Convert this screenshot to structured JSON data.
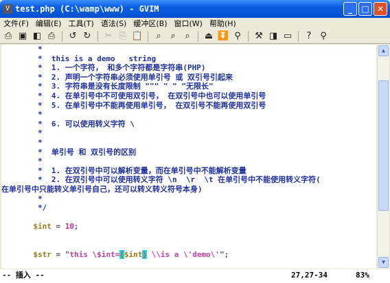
{
  "window": {
    "title": "test.php (C:\\wamp\\www) - GVIM",
    "buttons": [
      "_",
      "□",
      "✕"
    ]
  },
  "menu": [
    "文件(F)",
    "编辑(E)",
    "工具(T)",
    "语法(S)",
    "缓冲区(B)",
    "窗口(W)",
    "帮助(H)"
  ],
  "toolbar": [
    {
      "icon": "open-icon",
      "glyph": "⎙"
    },
    {
      "icon": "save-icon",
      "glyph": "▣"
    },
    {
      "icon": "save-all-icon",
      "glyph": "◧"
    },
    {
      "icon": "print-icon",
      "glyph": "⎙"
    },
    {
      "sep": true
    },
    {
      "icon": "undo-icon",
      "glyph": "↺"
    },
    {
      "icon": "redo-icon",
      "glyph": "↻"
    },
    {
      "sep": true
    },
    {
      "icon": "cut-icon",
      "glyph": "✂",
      "disabled": true
    },
    {
      "icon": "copy-icon",
      "glyph": "⎘",
      "disabled": true
    },
    {
      "icon": "paste-icon",
      "glyph": "📋"
    },
    {
      "sep": true
    },
    {
      "icon": "find-replace-icon",
      "glyph": "⌕"
    },
    {
      "icon": "find-next-icon",
      "glyph": "⌕"
    },
    {
      "icon": "find-prev-icon",
      "glyph": "⌕"
    },
    {
      "sep": true
    },
    {
      "icon": "load-session-icon",
      "glyph": "⏏"
    },
    {
      "icon": "save-session-icon",
      "glyph": "⏬"
    },
    {
      "icon": "run-script-icon",
      "glyph": "⚲"
    },
    {
      "sep": true
    },
    {
      "icon": "make-icon",
      "glyph": "⚒"
    },
    {
      "icon": "shell-icon",
      "glyph": "◨"
    },
    {
      "icon": "tag-icon",
      "glyph": "▭"
    },
    {
      "sep": true
    },
    {
      "icon": "help-icon",
      "glyph": "?"
    },
    {
      "icon": "find-help-icon",
      "glyph": "⚲"
    }
  ],
  "editor": {
    "lines": [
      [
        {
          "c": "cm",
          "t": "        *"
        }
      ],
      [
        {
          "c": "cm",
          "t": "        *  this is a demo   string"
        }
      ],
      [
        {
          "c": "cm",
          "t": "        *  1. 一个字符， 和多个字符都是字符串(PHP)"
        }
      ],
      [
        {
          "c": "cm",
          "t": "        *  2. 声明一个字符串必须使用单引号 或 双引号引起来"
        }
      ],
      [
        {
          "c": "cm",
          "t": "        *  3. 字符串是没有长度限制 \"\"\" \" \" \"无限长\""
        }
      ],
      [
        {
          "c": "cm",
          "t": "        *  4. 在单引号中不可使用双引号， 在双引号中也可以使用单引号"
        }
      ],
      [
        {
          "c": "cm",
          "t": "        *  5. 在单引号中不能再使用单引号， 在双引号不能再使用双引号"
        }
      ],
      [
        {
          "c": "cm",
          "t": "        *"
        }
      ],
      [
        {
          "c": "cm",
          "t": "        *  6. 可以使用转义字符 \\"
        }
      ],
      [
        {
          "c": "cm",
          "t": "        *"
        }
      ],
      [
        {
          "c": "cm",
          "t": "        *"
        }
      ],
      [
        {
          "c": "cm",
          "t": "        *  单引号 和 双引号的区别"
        }
      ],
      [
        {
          "c": "cm",
          "t": "        *"
        }
      ],
      [
        {
          "c": "cm",
          "t": "        *  1. 在双引号中可以解析变量，而在单引号中不能解析变量"
        }
      ],
      [
        {
          "c": "cm",
          "t": "        *  2. 在双引号中可以使用转义字符 \\n  \\r  \\t 在单引号中不能使用转义字符("
        }
      ],
      [
        {
          "c": "cm",
          "t": "在单引号中只能转义单引号自己，还可以转义转义符号本身)"
        }
      ],
      [
        {
          "c": "cm",
          "t": "        *"
        }
      ],
      [
        {
          "c": "cm",
          "t": "        */"
        }
      ],
      [
        {
          "c": "cm",
          "t": ""
        }
      ],
      [
        {
          "c": "var",
          "t": "       $int"
        },
        {
          "c": "op",
          "t": " = "
        },
        {
          "c": "num",
          "t": "10"
        },
        {
          "c": "op",
          "t": ";"
        }
      ],
      [
        {
          "c": "cm",
          "t": ""
        }
      ],
      [
        {
          "c": "cm",
          "t": ""
        }
      ],
      [
        {
          "c": "var",
          "t": "       $str"
        },
        {
          "c": "op",
          "t": " = \""
        },
        {
          "c": "str",
          "t": "this \\$int="
        },
        {
          "c": "hl",
          "t": "{"
        },
        {
          "c": "var",
          "t": "$int"
        },
        {
          "c": "hl",
          "t": "}"
        },
        {
          "c": "str",
          "t": " \\\\is a \\'demo\\'"
        },
        {
          "c": "op",
          "t": "\";"
        }
      ]
    ]
  },
  "status": {
    "mode": "-- 插入 --",
    "position": "27,27-34",
    "percent": "83%"
  },
  "scrollbar": {
    "position_percent": 83
  }
}
